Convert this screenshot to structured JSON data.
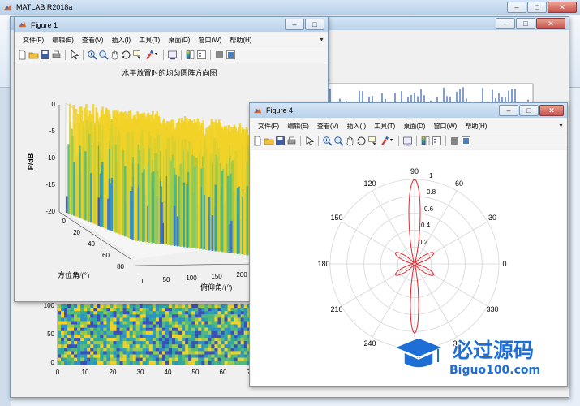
{
  "main_window": {
    "title": "MATLAB R2018a"
  },
  "menus": [
    "文件(F)",
    "编辑(E)",
    "查看(V)",
    "插入(I)",
    "工具(T)",
    "桌面(D)",
    "窗口(W)",
    "帮助(H)"
  ],
  "figure1": {
    "title": "Figure 1",
    "plot_title": "水平放置时的均匀圆阵方向图",
    "zlabel": "P/dB",
    "xlabel": "俯仰角/(°)",
    "ylabel": "方位角/(°)",
    "zticks": [
      "0",
      "-5",
      "-10",
      "-15",
      "-20"
    ],
    "yticks": [
      "0",
      "20",
      "40",
      "60",
      "80"
    ],
    "xticks": [
      "0",
      "50",
      "100",
      "150",
      "200"
    ]
  },
  "figure4": {
    "title": "Figure 4",
    "angle_labels": [
      "90",
      "60",
      "30",
      "0",
      "330",
      "300",
      "270",
      "240",
      "210",
      "180",
      "150",
      "120"
    ],
    "radial_labels": [
      "1",
      "0.8",
      "0.6",
      "0.4",
      "0.2"
    ]
  },
  "background_figure": {
    "yticks": [
      "100",
      "50",
      "0"
    ],
    "xticks": [
      "0",
      "10",
      "20",
      "30",
      "40",
      "50",
      "60",
      "70"
    ]
  },
  "watermark": {
    "main": "必过源码",
    "sub": "Biguo100.com"
  },
  "colors": {
    "titlebar_top": "#d5e5f5",
    "titlebar_bottom": "#b9d1ea",
    "close": "#c75050",
    "polar_curve": "#e8202a",
    "surface_high": "#f3d228",
    "surface_mid": "#2fa6a0",
    "surface_low": "#3a4fb8"
  }
}
